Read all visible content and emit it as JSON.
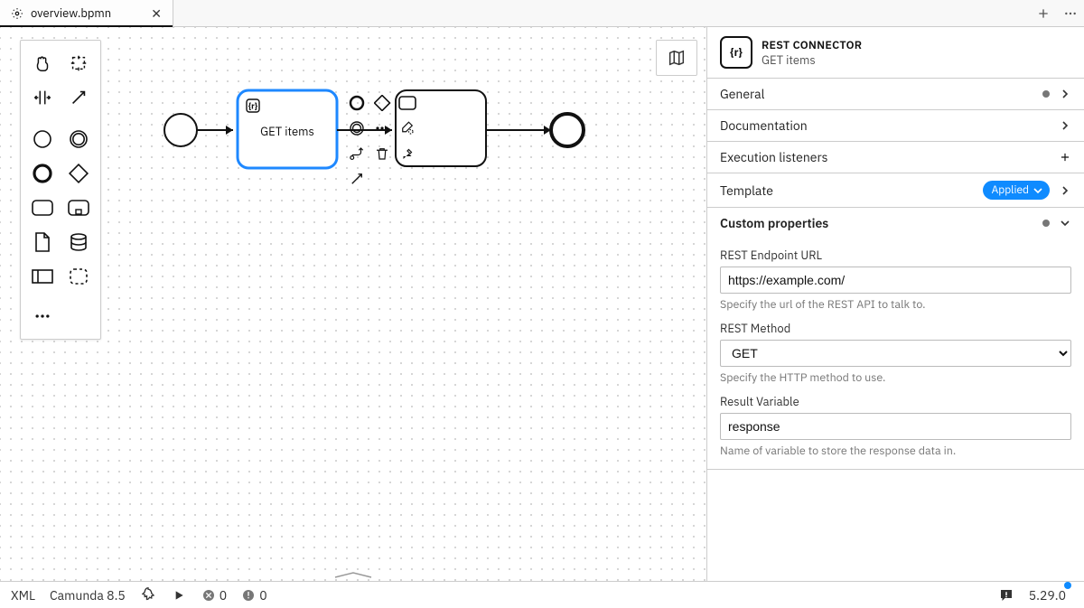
{
  "tabs": {
    "active": {
      "label": "overview.bpmn"
    }
  },
  "diagram": {
    "task_selected_label": "GET items"
  },
  "panel": {
    "header_type": "REST CONNECTOR",
    "header_name": "GET items",
    "sections": {
      "general": {
        "title": "General"
      },
      "documentation": {
        "title": "Documentation"
      },
      "execution_listeners": {
        "title": "Execution listeners"
      },
      "template": {
        "title": "Template",
        "badge": "Applied"
      },
      "custom": {
        "title": "Custom properties",
        "fields": {
          "endpoint": {
            "label": "REST Endpoint URL",
            "value": "https://example.com/",
            "hint": "Specify the url of the REST API to talk to."
          },
          "method": {
            "label": "REST Method",
            "value": "GET",
            "hint": "Specify the HTTP method to use."
          },
          "result_var": {
            "label": "Result Variable",
            "value": "response",
            "hint": "Name of variable to store the response data in."
          }
        }
      }
    }
  },
  "statusbar": {
    "xml": "XML",
    "engine": "Camunda 8.5",
    "errors": "0",
    "warnings": "0",
    "version": "5.29.0"
  }
}
